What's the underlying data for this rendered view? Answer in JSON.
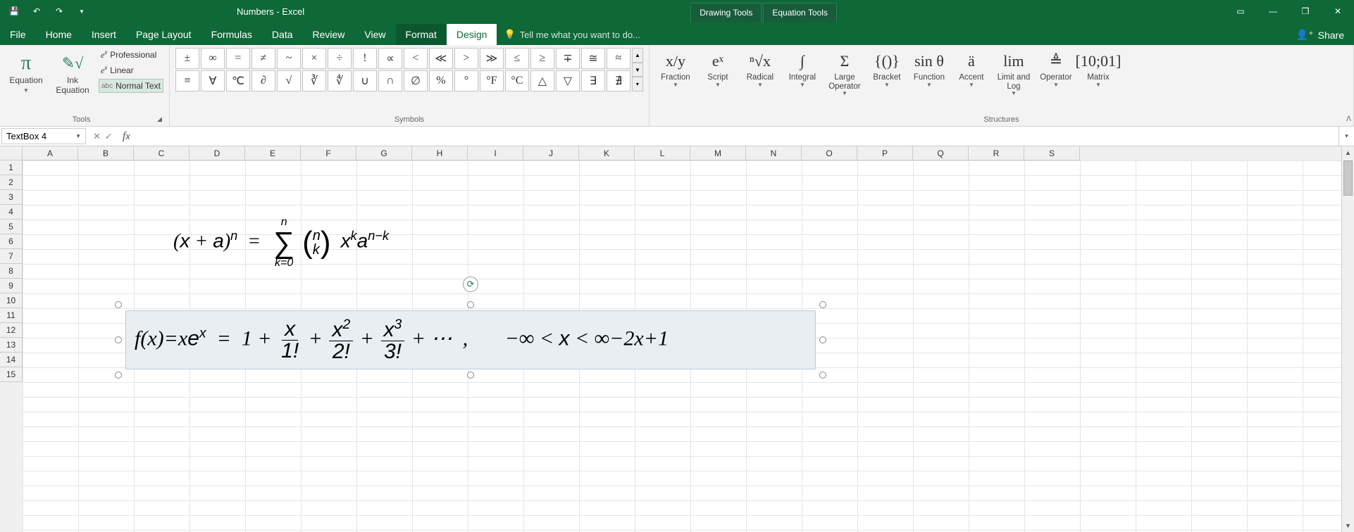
{
  "titlebar": {
    "title": "Numbers - Excel",
    "contextual": [
      "Drawing Tools",
      "Equation Tools"
    ]
  },
  "tabs": {
    "items": [
      "File",
      "Home",
      "Insert",
      "Page Layout",
      "Formulas",
      "Data",
      "Review",
      "View",
      "Format",
      "Design"
    ],
    "active": "Design",
    "tell_me": "Tell me what you want to do...",
    "share": "Share"
  },
  "ribbon": {
    "tools": {
      "label": "Tools",
      "equation": "Equation",
      "ink_equation": "Ink\nEquation",
      "professional": "Professional",
      "linear": "Linear",
      "normal_text": "Normal Text"
    },
    "symbols": {
      "label": "Symbols",
      "row1": [
        "±",
        "∞",
        "=",
        "≠",
        "~",
        "×",
        "÷",
        "!",
        "∝",
        "<",
        "≪",
        ">",
        "≫",
        "≤",
        "≥",
        "∓",
        "≅",
        "≈"
      ],
      "row2": [
        "≡",
        "∀",
        "℃",
        "∂",
        "√",
        "∛",
        "∜",
        "∪",
        "∩",
        "∅",
        "%",
        "°",
        "°F",
        "°C",
        "△",
        "▽",
        "∃",
        "∄"
      ]
    },
    "structures": {
      "label": "Structures",
      "items": [
        "Fraction",
        "Script",
        "Radical",
        "Integral",
        "Large\nOperator",
        "Bracket",
        "Function",
        "Accent",
        "Limit and\nLog",
        "Operator",
        "Matrix"
      ],
      "icons": [
        "x/y",
        "eˣ",
        "ⁿ√x",
        "∫",
        "Σ",
        "{()}",
        "sin θ",
        "ä",
        "lim",
        "≜",
        "[10;01]"
      ]
    }
  },
  "formula_bar": {
    "name": "TextBox 4",
    "value": ""
  },
  "sheet": {
    "columns": [
      "A",
      "B",
      "C",
      "D",
      "E",
      "F",
      "G",
      "H",
      "I",
      "J",
      "K",
      "L",
      "M",
      "N",
      "O",
      "P",
      "Q",
      "R",
      "S"
    ],
    "rows": [
      "1",
      "2",
      "3",
      "4",
      "5",
      "6",
      "7",
      "8",
      "9",
      "10",
      "11",
      "12",
      "13",
      "14",
      "15"
    ]
  },
  "equations": {
    "eq1": "(x + a)ⁿ = Σ (n choose k) xᵏ aⁿ⁻ᵏ , k=0..n",
    "eq2": "f(x)=xeˣ = 1 + x/1! + x²/2! + x³/3! + ⋯ ,    −∞ < x < ∞−2x+1"
  }
}
